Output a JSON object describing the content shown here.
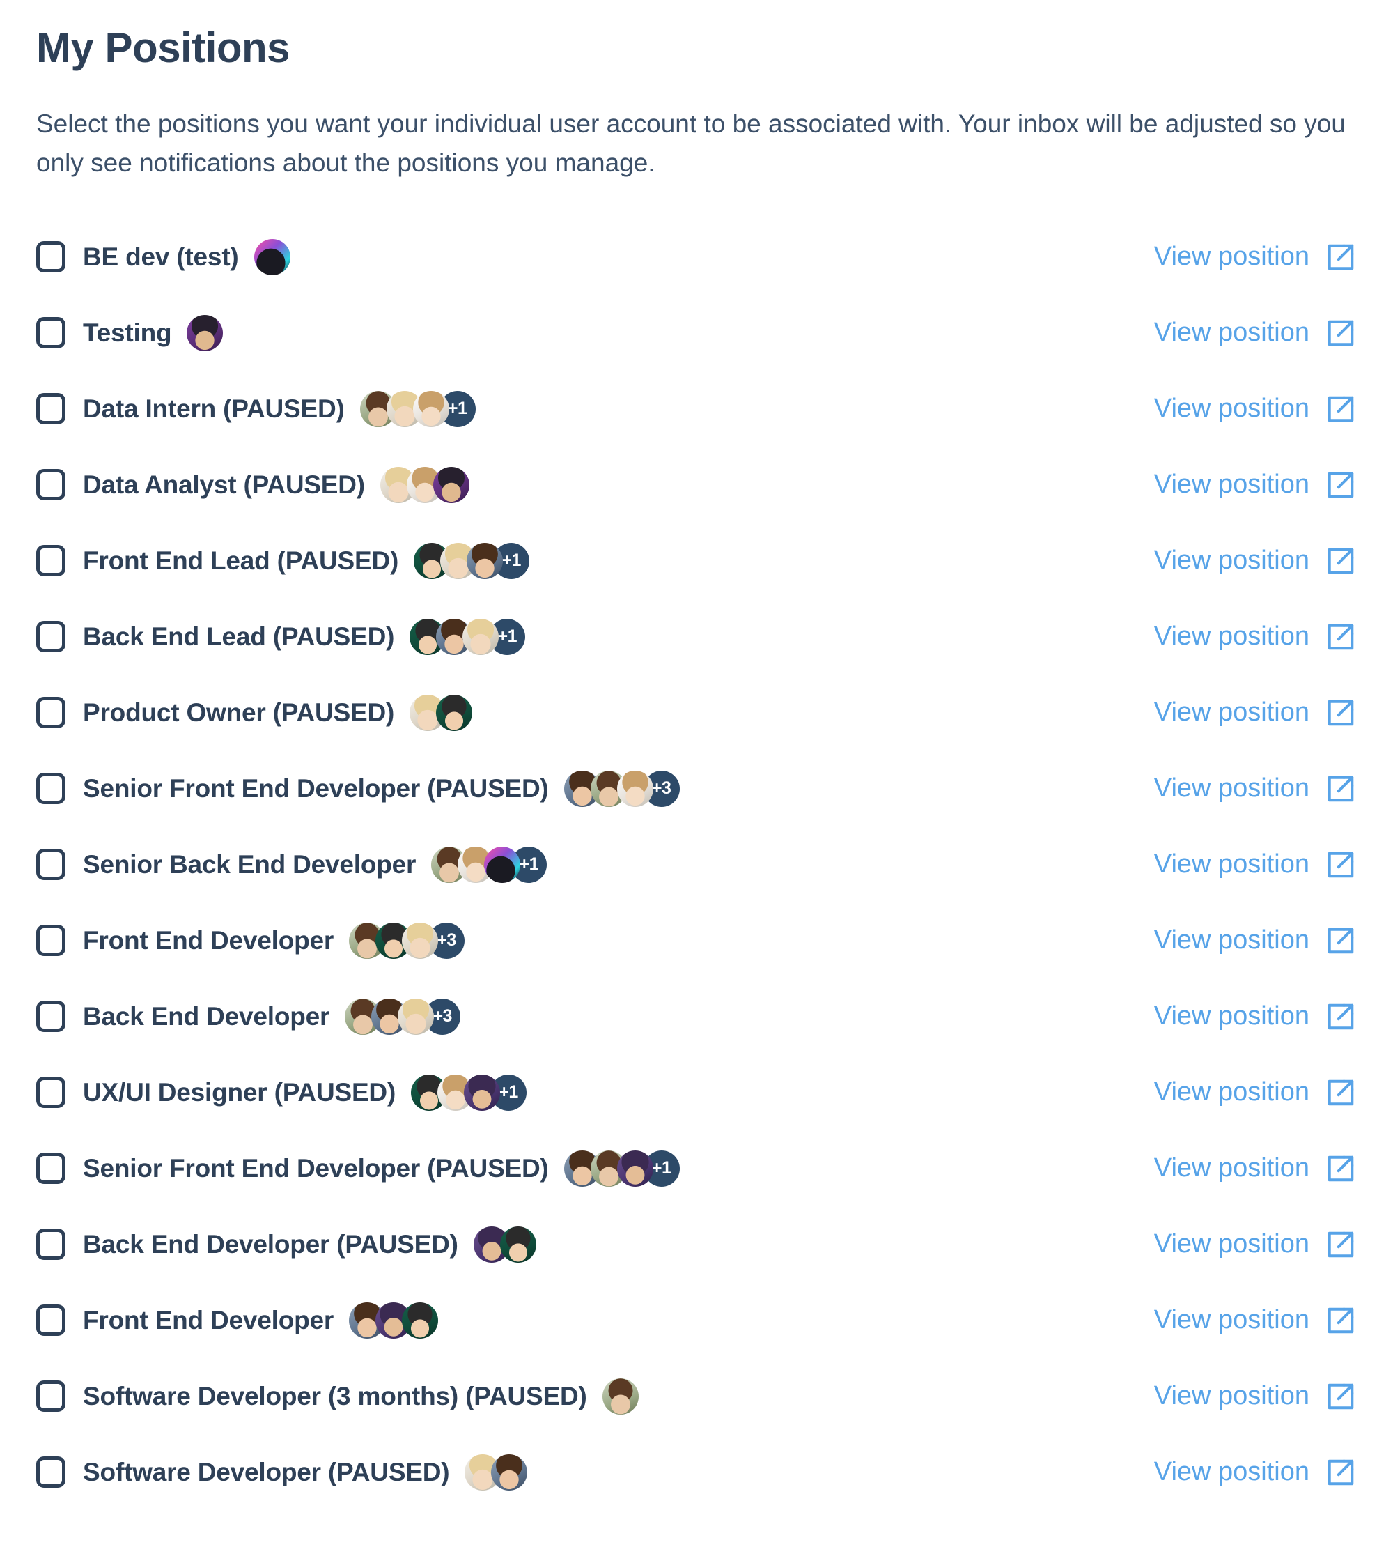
{
  "header": {
    "title": "My Positions",
    "description": "Select the positions you want your individual user account to be associated with. Your inbox will be adjusted so you only see notifications about the positions you manage."
  },
  "colors": {
    "text_navy": "#2e4057",
    "link_blue": "#57a3e8",
    "badge_navy": "#2d4a68",
    "background": "#ffffff"
  },
  "row_action": {
    "label": "View position",
    "icon": "external-link-icon"
  },
  "checkbox": {
    "checked": false,
    "icon": "checkbox-unchecked-icon"
  },
  "positions": [
    {
      "label": "BE dev (test)",
      "avatars": [
        "av-f"
      ],
      "more": null,
      "checked": false
    },
    {
      "label": "Testing",
      "avatars": [
        "av-g"
      ],
      "more": null,
      "checked": false
    },
    {
      "label": "Data Intern (PAUSED)",
      "avatars": [
        "av-a",
        "av-b",
        "av-h"
      ],
      "more": "+1",
      "checked": false
    },
    {
      "label": "Data Analyst (PAUSED)",
      "avatars": [
        "av-b",
        "av-h",
        "av-g"
      ],
      "more": null,
      "checked": false
    },
    {
      "label": "Front End Lead (PAUSED)",
      "avatars": [
        "av-d",
        "av-b",
        "av-e"
      ],
      "more": "+1",
      "checked": false
    },
    {
      "label": "Back End Lead (PAUSED)",
      "avatars": [
        "av-d",
        "av-e",
        "av-b"
      ],
      "more": "+1",
      "checked": false
    },
    {
      "label": "Product Owner (PAUSED)",
      "avatars": [
        "av-b",
        "av-d"
      ],
      "more": null,
      "checked": false
    },
    {
      "label": "Senior Front End Developer (PAUSED)",
      "avatars": [
        "av-e",
        "av-a",
        "av-h"
      ],
      "more": "+3",
      "checked": false
    },
    {
      "label": "Senior Back End Developer",
      "avatars": [
        "av-a",
        "av-h",
        "av-f"
      ],
      "more": "+1",
      "checked": false
    },
    {
      "label": "Front End Developer",
      "avatars": [
        "av-a",
        "av-d",
        "av-b"
      ],
      "more": "+3",
      "checked": false
    },
    {
      "label": "Back End Developer",
      "avatars": [
        "av-a",
        "av-e",
        "av-b"
      ],
      "more": "+3",
      "checked": false
    },
    {
      "label": "UX/UI Designer (PAUSED)",
      "avatars": [
        "av-d",
        "av-h",
        "av-c"
      ],
      "more": "+1",
      "checked": false
    },
    {
      "label": "Senior Front End Developer (PAUSED)",
      "avatars": [
        "av-e",
        "av-a",
        "av-c"
      ],
      "more": "+1",
      "checked": false
    },
    {
      "label": "Back End Developer (PAUSED)",
      "avatars": [
        "av-c",
        "av-d"
      ],
      "more": null,
      "checked": false
    },
    {
      "label": "Front End Developer",
      "avatars": [
        "av-e",
        "av-c",
        "av-d"
      ],
      "more": null,
      "checked": false
    },
    {
      "label": "Software Developer (3 months) (PAUSED)",
      "avatars": [
        "av-a"
      ],
      "more": null,
      "checked": false
    },
    {
      "label": "Software Developer (PAUSED)",
      "avatars": [
        "av-b",
        "av-e"
      ],
      "more": null,
      "checked": false
    }
  ]
}
